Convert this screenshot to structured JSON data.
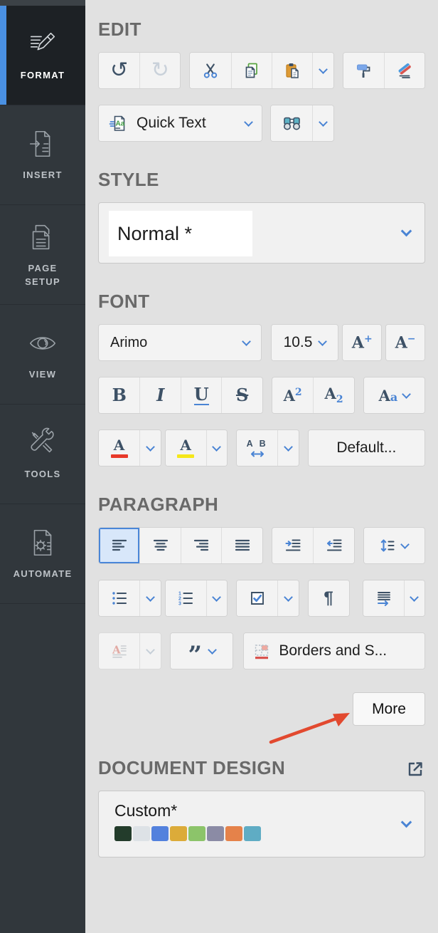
{
  "sidebar": {
    "tabs": [
      {
        "label": "FORMAT",
        "active": true
      },
      {
        "label": "INSERT",
        "active": false
      },
      {
        "label": "PAGE SETUP",
        "active": false
      },
      {
        "label": "VIEW",
        "active": false
      },
      {
        "label": "TOOLS",
        "active": false
      },
      {
        "label": "AUTOMATE",
        "active": false
      }
    ]
  },
  "edit": {
    "title": "EDIT",
    "quick_text_label": "Quick Text"
  },
  "style": {
    "title": "STYLE",
    "current": "Normal *"
  },
  "font": {
    "title": "FONT",
    "family": "Arimo",
    "size": "10.5",
    "inc_base": "A",
    "inc_sign": "+",
    "dec_base": "A",
    "dec_sign": "−",
    "bold": "B",
    "italic": "I",
    "underline": "U",
    "strike": "S",
    "sup_base": "A",
    "sup_exp": "2",
    "sub_base": "A",
    "sub_exp": "2",
    "case_cap": "A",
    "case_low": "a",
    "color_letter": "A",
    "highlight_letter": "A",
    "spacing_letters": "A B",
    "default_label": "Default..."
  },
  "paragraph": {
    "title": "PARAGRAPH",
    "numbers": [
      "1",
      "2",
      "3"
    ],
    "pilcrow": "¶",
    "dropcap_letter": "A",
    "quote_mark": "”",
    "borders_label": "Borders and S..."
  },
  "more_label": "More",
  "document_design": {
    "title": "DOCUMENT DESIGN",
    "current": "Custom*",
    "swatches": [
      "#233c2b",
      "#dde2e6",
      "#5381dd",
      "#dcab39",
      "#8cc46a",
      "#8b8ba5",
      "#e5824a",
      "#5facc4"
    ]
  },
  "icons": {
    "quick_text_glyph": "Aa"
  },
  "colors": {
    "accent_blue": "#4a84d4",
    "font_color_bar": "#e8392a",
    "highlight_bar": "#f5e71a",
    "active_tab_bar": "#4a90e2",
    "annotation_arrow": "#e2492f"
  }
}
